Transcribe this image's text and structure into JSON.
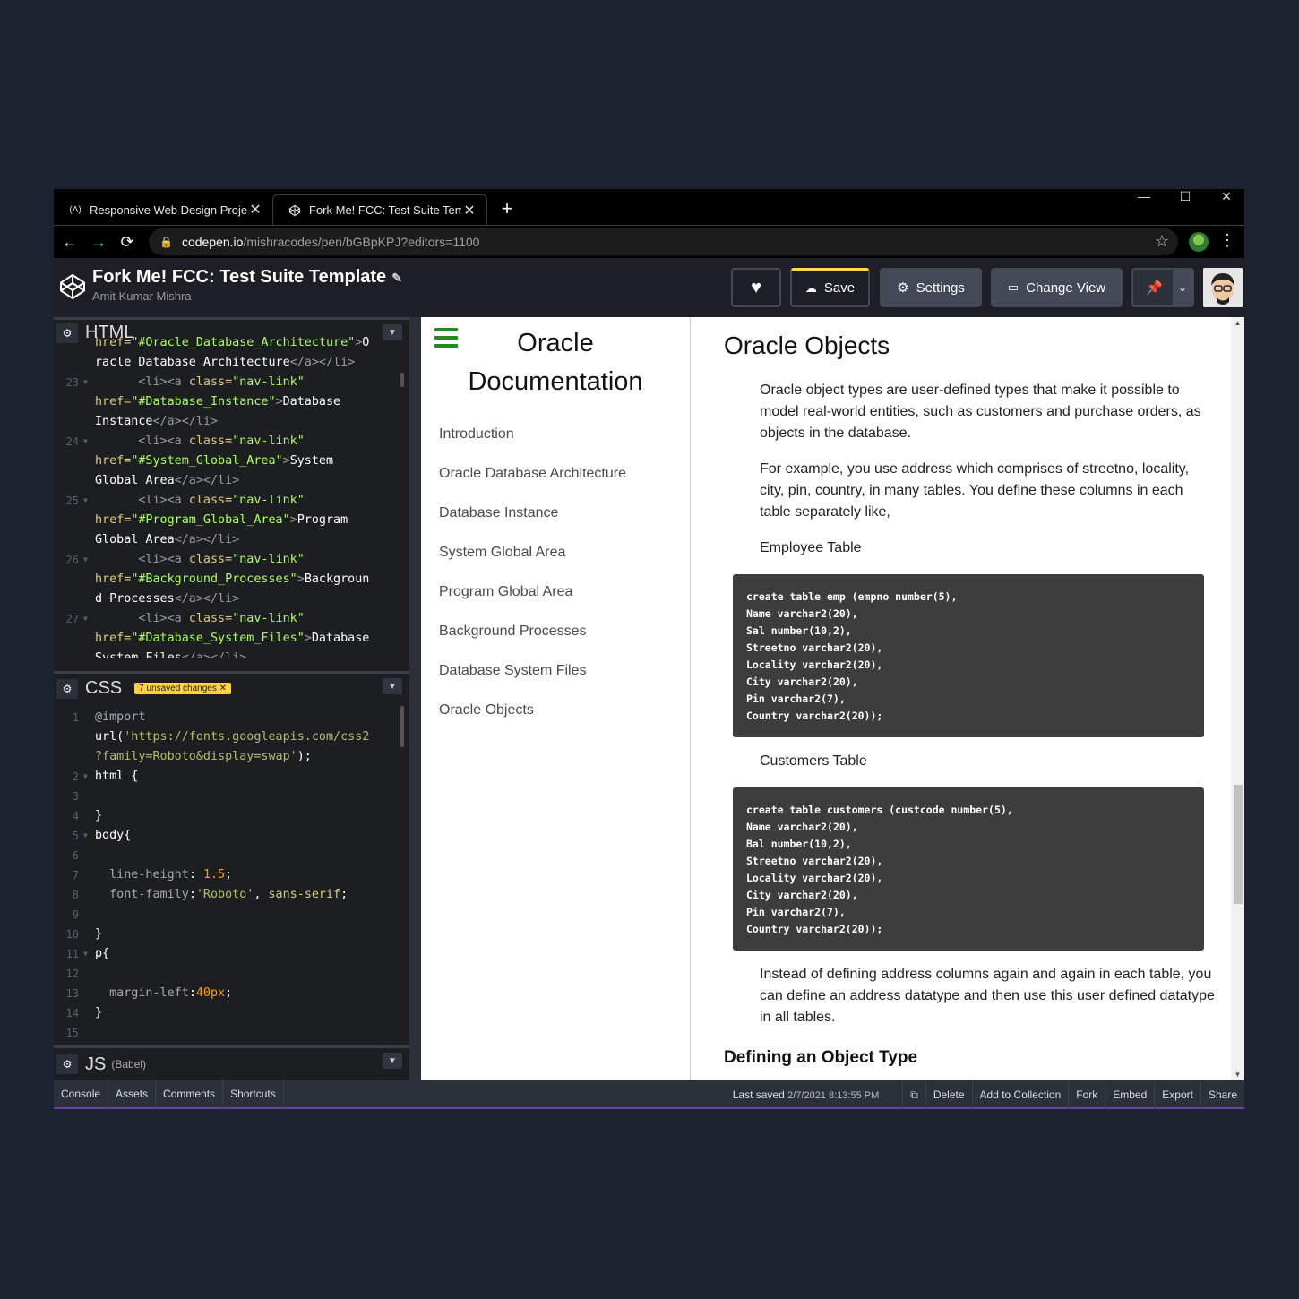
{
  "browser": {
    "tabs": [
      {
        "label": "Responsive Web Design Projects",
        "icon": "freecodecamp-icon"
      },
      {
        "label": "Fork Me! FCC: Test Suite Template",
        "icon": "codepen-icon"
      }
    ],
    "new_tab": "+",
    "url_host": "codepen.io",
    "url_path": "/mishracodes/pen/bGBpKPJ?editors=1100"
  },
  "pen": {
    "title": "Fork Me! FCC: Test Suite Template",
    "author": "Amit Kumar Mishra",
    "buttons": {
      "save": "Save",
      "settings": "Settings",
      "change_view": "Change View"
    }
  },
  "editors": {
    "html": {
      "name": "HTML",
      "lines": [
        {
          "n": "",
          "html": "<span class=\"attr\">href=</span><span class=\"str\">\"#Oracle_Database_Architecture\"</span><span class=\"tag\">&gt;</span>O"
        },
        {
          "n": "",
          "html": "racle Database Architecture<span class=\"tag\">&lt;/a&gt;&lt;/li&gt;</span>"
        },
        {
          "n": "23",
          "html": "      <span class=\"tag\">&lt;li&gt;&lt;a</span> <span class=\"attr\">class=</span><span class=\"str\">\"nav-link\"</span>"
        },
        {
          "n": "",
          "html": "<span class=\"attr\">href=</span><span class=\"str\">\"#Database_Instance\"</span><span class=\"tag\">&gt;</span>Database"
        },
        {
          "n": "",
          "html": "Instance<span class=\"tag\">&lt;/a&gt;&lt;/li&gt;</span>"
        },
        {
          "n": "24",
          "html": "      <span class=\"tag\">&lt;li&gt;&lt;a</span> <span class=\"attr\">class=</span><span class=\"str\">\"nav-link\"</span>"
        },
        {
          "n": "",
          "html": "<span class=\"attr\">href=</span><span class=\"str\">\"#System_Global_Area\"</span><span class=\"tag\">&gt;</span>System"
        },
        {
          "n": "",
          "html": "Global Area<span class=\"tag\">&lt;/a&gt;&lt;/li&gt;</span>"
        },
        {
          "n": "25",
          "html": "      <span class=\"tag\">&lt;li&gt;&lt;a</span> <span class=\"attr\">class=</span><span class=\"str\">\"nav-link\"</span>"
        },
        {
          "n": "",
          "html": "<span class=\"attr\">href=</span><span class=\"str\">\"#Program_Global_Area\"</span><span class=\"tag\">&gt;</span>Program"
        },
        {
          "n": "",
          "html": "Global Area<span class=\"tag\">&lt;/a&gt;&lt;/li&gt;</span>"
        },
        {
          "n": "26",
          "html": "      <span class=\"tag\">&lt;li&gt;&lt;a</span> <span class=\"attr\">class=</span><span class=\"str\">\"nav-link\"</span>"
        },
        {
          "n": "",
          "html": "<span class=\"attr\">href=</span><span class=\"str\">\"#Background_Processes\"</span><span class=\"tag\">&gt;</span>Backgroun"
        },
        {
          "n": "",
          "html": "d Processes<span class=\"tag\">&lt;/a&gt;&lt;/li&gt;</span>"
        },
        {
          "n": "27",
          "html": "      <span class=\"tag\">&lt;li&gt;&lt;a</span> <span class=\"attr\">class=</span><span class=\"str\">\"nav-link\"</span>"
        },
        {
          "n": "",
          "html": "<span class=\"attr\">href=</span><span class=\"str\">\"#Database_System_Files\"</span><span class=\"tag\">&gt;</span>Database"
        },
        {
          "n": "",
          "html": "System Files<span class=\"tag\">&lt;/a&gt;&lt;/li&gt;</span>"
        }
      ]
    },
    "css": {
      "name": "CSS",
      "badge": "7 unsaved changes",
      "lines": [
        {
          "n": "1",
          "html": "<span class=\"kw\">@import</span>"
        },
        {
          "n": "",
          "html": "url(<span class=\"strg\">'https://fonts.googleapis.com/css2</span>"
        },
        {
          "n": "",
          "html": "<span class=\"strg\">?family=Roboto&amp;display=swap'</span>);"
        },
        {
          "n": "2",
          "html": "html {"
        },
        {
          "n": "3",
          "html": ""
        },
        {
          "n": "4",
          "html": "}"
        },
        {
          "n": "5",
          "html": "body{"
        },
        {
          "n": "6",
          "html": ""
        },
        {
          "n": "7",
          "html": "  <span class=\"prop\">line-height</span>: <span class=\"num\">1.5</span>;"
        },
        {
          "n": "8",
          "html": "  <span class=\"prop\">font-family</span>:<span class=\"strg\">'Roboto'</span>, <span class=\"val\">sans-serif</span>;"
        },
        {
          "n": "9",
          "html": ""
        },
        {
          "n": "10",
          "html": "}"
        },
        {
          "n": "11",
          "html": "p{"
        },
        {
          "n": "12",
          "html": ""
        },
        {
          "n": "13",
          "html": "  <span class=\"prop\">margin-left</span>:<span class=\"num\">40px</span>;"
        },
        {
          "n": "14",
          "html": "}"
        },
        {
          "n": "15",
          "html": ""
        }
      ]
    },
    "js": {
      "name": "JS",
      "sub": "(Babel)"
    }
  },
  "preview": {
    "nav_title": "Oracle Documentation",
    "nav_links": [
      "Introduction",
      "Oracle Database Architecture",
      "Database Instance",
      "System Global Area",
      "Program Global Area",
      "Background Processes",
      "Database System Files",
      "Oracle Objects"
    ],
    "section_title": "Oracle Objects",
    "p1": "Oracle object types are user-defined types that make it possible to model real-world entities, such as customers and purchase orders, as objects in the database.",
    "p2": "For example, you use address which comprises of streetno, locality, city, pin, country, in many tables. You define these columns in each table separately like,",
    "label_employee": "Employee Table",
    "code_employee": "create table emp (empno number(5),\nName varchar2(20),\nSal number(10,2),\nStreetno varchar2(20),\nLocality varchar2(20),\nCity varchar2(20),\nPin varchar2(7),\nCountry varchar2(20));",
    "label_customers": "Customers Table",
    "code_customers": "create table customers (custcode number(5),\nName varchar2(20),\nBal number(10,2),\nStreetno varchar2(20),\nLocality varchar2(20),\nCity varchar2(20),\nPin varchar2(7),\nCountry varchar2(20));",
    "p3": "Instead of defining address columns again and again in each table, you can define an address datatype and then use this user defined datatype in all tables.",
    "subheading": "Defining an Object Type"
  },
  "footer": {
    "left": [
      "Console",
      "Assets",
      "Comments",
      "Shortcuts"
    ],
    "last_saved_label": "Last saved",
    "last_saved_time": "2/7/2021 8:13:55 PM",
    "right": [
      "Delete",
      "Add to Collection",
      "Fork",
      "Embed",
      "Export",
      "Share"
    ]
  }
}
